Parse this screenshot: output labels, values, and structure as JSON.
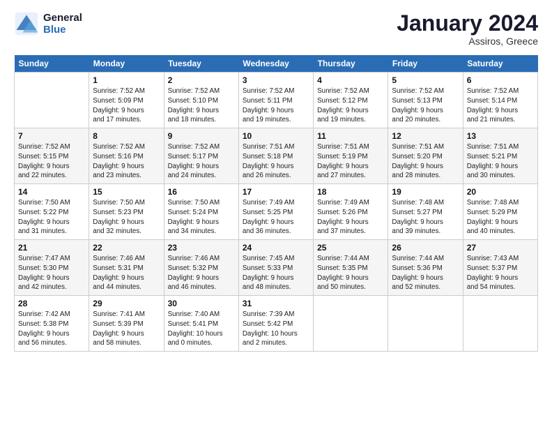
{
  "logo": {
    "text_line1": "General",
    "text_line2": "Blue"
  },
  "header": {
    "month": "January 2024",
    "location": "Assiros, Greece"
  },
  "days_of_week": [
    "Sunday",
    "Monday",
    "Tuesday",
    "Wednesday",
    "Thursday",
    "Friday",
    "Saturday"
  ],
  "weeks": [
    [
      {
        "day": "",
        "info": ""
      },
      {
        "day": "1",
        "info": "Sunrise: 7:52 AM\nSunset: 5:09 PM\nDaylight: 9 hours\nand 17 minutes."
      },
      {
        "day": "2",
        "info": "Sunrise: 7:52 AM\nSunset: 5:10 PM\nDaylight: 9 hours\nand 18 minutes."
      },
      {
        "day": "3",
        "info": "Sunrise: 7:52 AM\nSunset: 5:11 PM\nDaylight: 9 hours\nand 19 minutes."
      },
      {
        "day": "4",
        "info": "Sunrise: 7:52 AM\nSunset: 5:12 PM\nDaylight: 9 hours\nand 19 minutes."
      },
      {
        "day": "5",
        "info": "Sunrise: 7:52 AM\nSunset: 5:13 PM\nDaylight: 9 hours\nand 20 minutes."
      },
      {
        "day": "6",
        "info": "Sunrise: 7:52 AM\nSunset: 5:14 PM\nDaylight: 9 hours\nand 21 minutes."
      }
    ],
    [
      {
        "day": "7",
        "info": "Sunrise: 7:52 AM\nSunset: 5:15 PM\nDaylight: 9 hours\nand 22 minutes."
      },
      {
        "day": "8",
        "info": "Sunrise: 7:52 AM\nSunset: 5:16 PM\nDaylight: 9 hours\nand 23 minutes."
      },
      {
        "day": "9",
        "info": "Sunrise: 7:52 AM\nSunset: 5:17 PM\nDaylight: 9 hours\nand 24 minutes."
      },
      {
        "day": "10",
        "info": "Sunrise: 7:51 AM\nSunset: 5:18 PM\nDaylight: 9 hours\nand 26 minutes."
      },
      {
        "day": "11",
        "info": "Sunrise: 7:51 AM\nSunset: 5:19 PM\nDaylight: 9 hours\nand 27 minutes."
      },
      {
        "day": "12",
        "info": "Sunrise: 7:51 AM\nSunset: 5:20 PM\nDaylight: 9 hours\nand 28 minutes."
      },
      {
        "day": "13",
        "info": "Sunrise: 7:51 AM\nSunset: 5:21 PM\nDaylight: 9 hours\nand 30 minutes."
      }
    ],
    [
      {
        "day": "14",
        "info": "Sunrise: 7:50 AM\nSunset: 5:22 PM\nDaylight: 9 hours\nand 31 minutes."
      },
      {
        "day": "15",
        "info": "Sunrise: 7:50 AM\nSunset: 5:23 PM\nDaylight: 9 hours\nand 32 minutes."
      },
      {
        "day": "16",
        "info": "Sunrise: 7:50 AM\nSunset: 5:24 PM\nDaylight: 9 hours\nand 34 minutes."
      },
      {
        "day": "17",
        "info": "Sunrise: 7:49 AM\nSunset: 5:25 PM\nDaylight: 9 hours\nand 36 minutes."
      },
      {
        "day": "18",
        "info": "Sunrise: 7:49 AM\nSunset: 5:26 PM\nDaylight: 9 hours\nand 37 minutes."
      },
      {
        "day": "19",
        "info": "Sunrise: 7:48 AM\nSunset: 5:27 PM\nDaylight: 9 hours\nand 39 minutes."
      },
      {
        "day": "20",
        "info": "Sunrise: 7:48 AM\nSunset: 5:29 PM\nDaylight: 9 hours\nand 40 minutes."
      }
    ],
    [
      {
        "day": "21",
        "info": "Sunrise: 7:47 AM\nSunset: 5:30 PM\nDaylight: 9 hours\nand 42 minutes."
      },
      {
        "day": "22",
        "info": "Sunrise: 7:46 AM\nSunset: 5:31 PM\nDaylight: 9 hours\nand 44 minutes."
      },
      {
        "day": "23",
        "info": "Sunrise: 7:46 AM\nSunset: 5:32 PM\nDaylight: 9 hours\nand 46 minutes."
      },
      {
        "day": "24",
        "info": "Sunrise: 7:45 AM\nSunset: 5:33 PM\nDaylight: 9 hours\nand 48 minutes."
      },
      {
        "day": "25",
        "info": "Sunrise: 7:44 AM\nSunset: 5:35 PM\nDaylight: 9 hours\nand 50 minutes."
      },
      {
        "day": "26",
        "info": "Sunrise: 7:44 AM\nSunset: 5:36 PM\nDaylight: 9 hours\nand 52 minutes."
      },
      {
        "day": "27",
        "info": "Sunrise: 7:43 AM\nSunset: 5:37 PM\nDaylight: 9 hours\nand 54 minutes."
      }
    ],
    [
      {
        "day": "28",
        "info": "Sunrise: 7:42 AM\nSunset: 5:38 PM\nDaylight: 9 hours\nand 56 minutes."
      },
      {
        "day": "29",
        "info": "Sunrise: 7:41 AM\nSunset: 5:39 PM\nDaylight: 9 hours\nand 58 minutes."
      },
      {
        "day": "30",
        "info": "Sunrise: 7:40 AM\nSunset: 5:41 PM\nDaylight: 10 hours\nand 0 minutes."
      },
      {
        "day": "31",
        "info": "Sunrise: 7:39 AM\nSunset: 5:42 PM\nDaylight: 10 hours\nand 2 minutes."
      },
      {
        "day": "",
        "info": ""
      },
      {
        "day": "",
        "info": ""
      },
      {
        "day": "",
        "info": ""
      }
    ]
  ]
}
